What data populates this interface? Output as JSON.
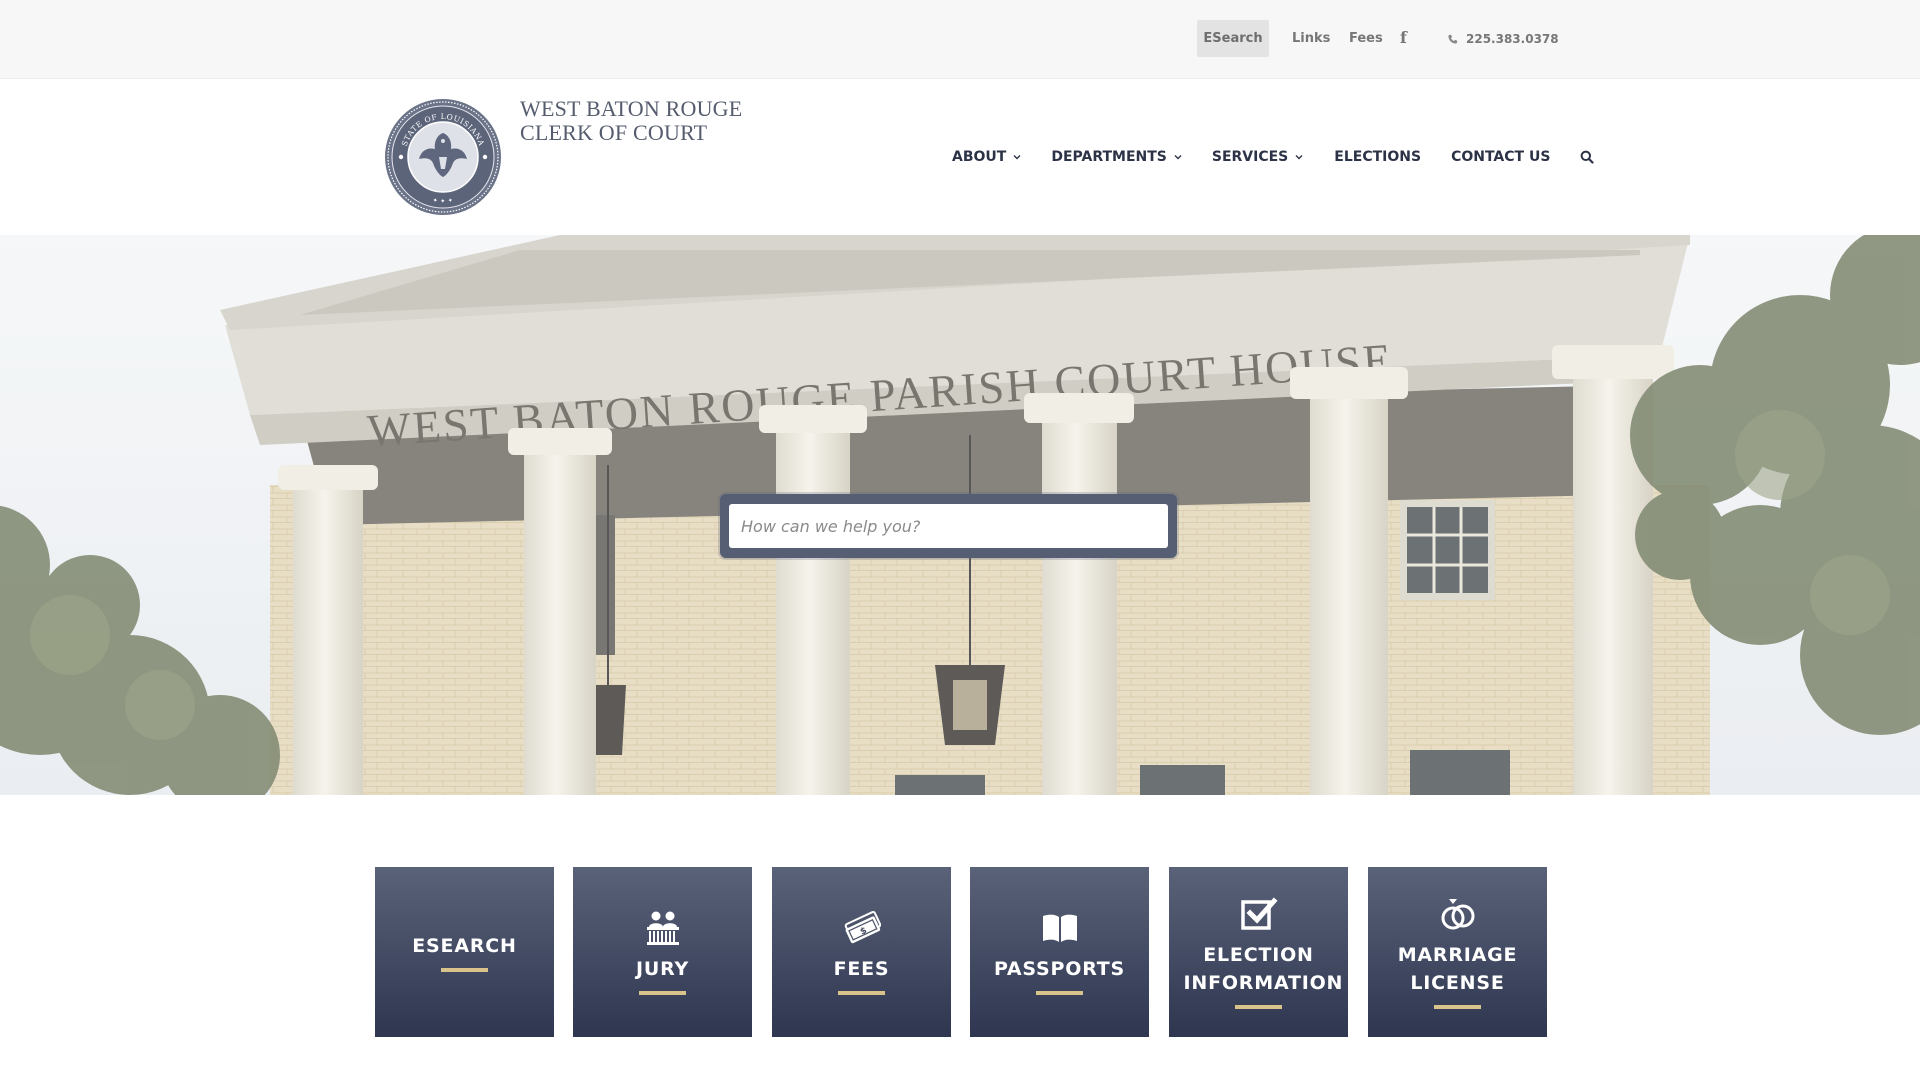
{
  "colors": {
    "nav_text": "#2c3347",
    "tile_top": "#5a6279",
    "tile_bottom": "#2f3650",
    "tile_accent": "#d8c48a",
    "search_frame": "#555e73"
  },
  "topbar": {
    "esearch_label": "ESearch",
    "links_label": "Links",
    "fees_label": "Fees",
    "facebook_icon": "facebook-icon",
    "facebook_glyph": "f",
    "phone_icon": "phone-icon",
    "phone": "225.383.0378"
  },
  "header": {
    "logo_line1": "WEST BATON ROUGE",
    "logo_line2": "CLERK OF COURT",
    "seal_text": "STATE OF LOUISIANA"
  },
  "nav": {
    "items": [
      {
        "label": "ABOUT",
        "dropdown": true
      },
      {
        "label": "DEPARTMENTS",
        "dropdown": true
      },
      {
        "label": "SERVICES",
        "dropdown": true
      },
      {
        "label": "ELECTIONS",
        "dropdown": false
      },
      {
        "label": "CONTACT US",
        "dropdown": false
      }
    ],
    "search_icon": "search-icon"
  },
  "hero": {
    "building_inscription": "WEST BATON ROUGE PARISH COURT HOUSE",
    "search_placeholder": "How can we help you?"
  },
  "tiles": [
    {
      "label": "ESEARCH",
      "icon": "none"
    },
    {
      "label": "JURY",
      "icon": "jury-box-icon"
    },
    {
      "label": "FEES",
      "icon": "money-icon"
    },
    {
      "label": "PASSPORTS",
      "icon": "open-book-icon"
    },
    {
      "label": "ELECTION INFORMATION",
      "icon": "checkbox-icon"
    },
    {
      "label": "MARRIAGE LICENSE",
      "icon": "rings-icon"
    }
  ]
}
